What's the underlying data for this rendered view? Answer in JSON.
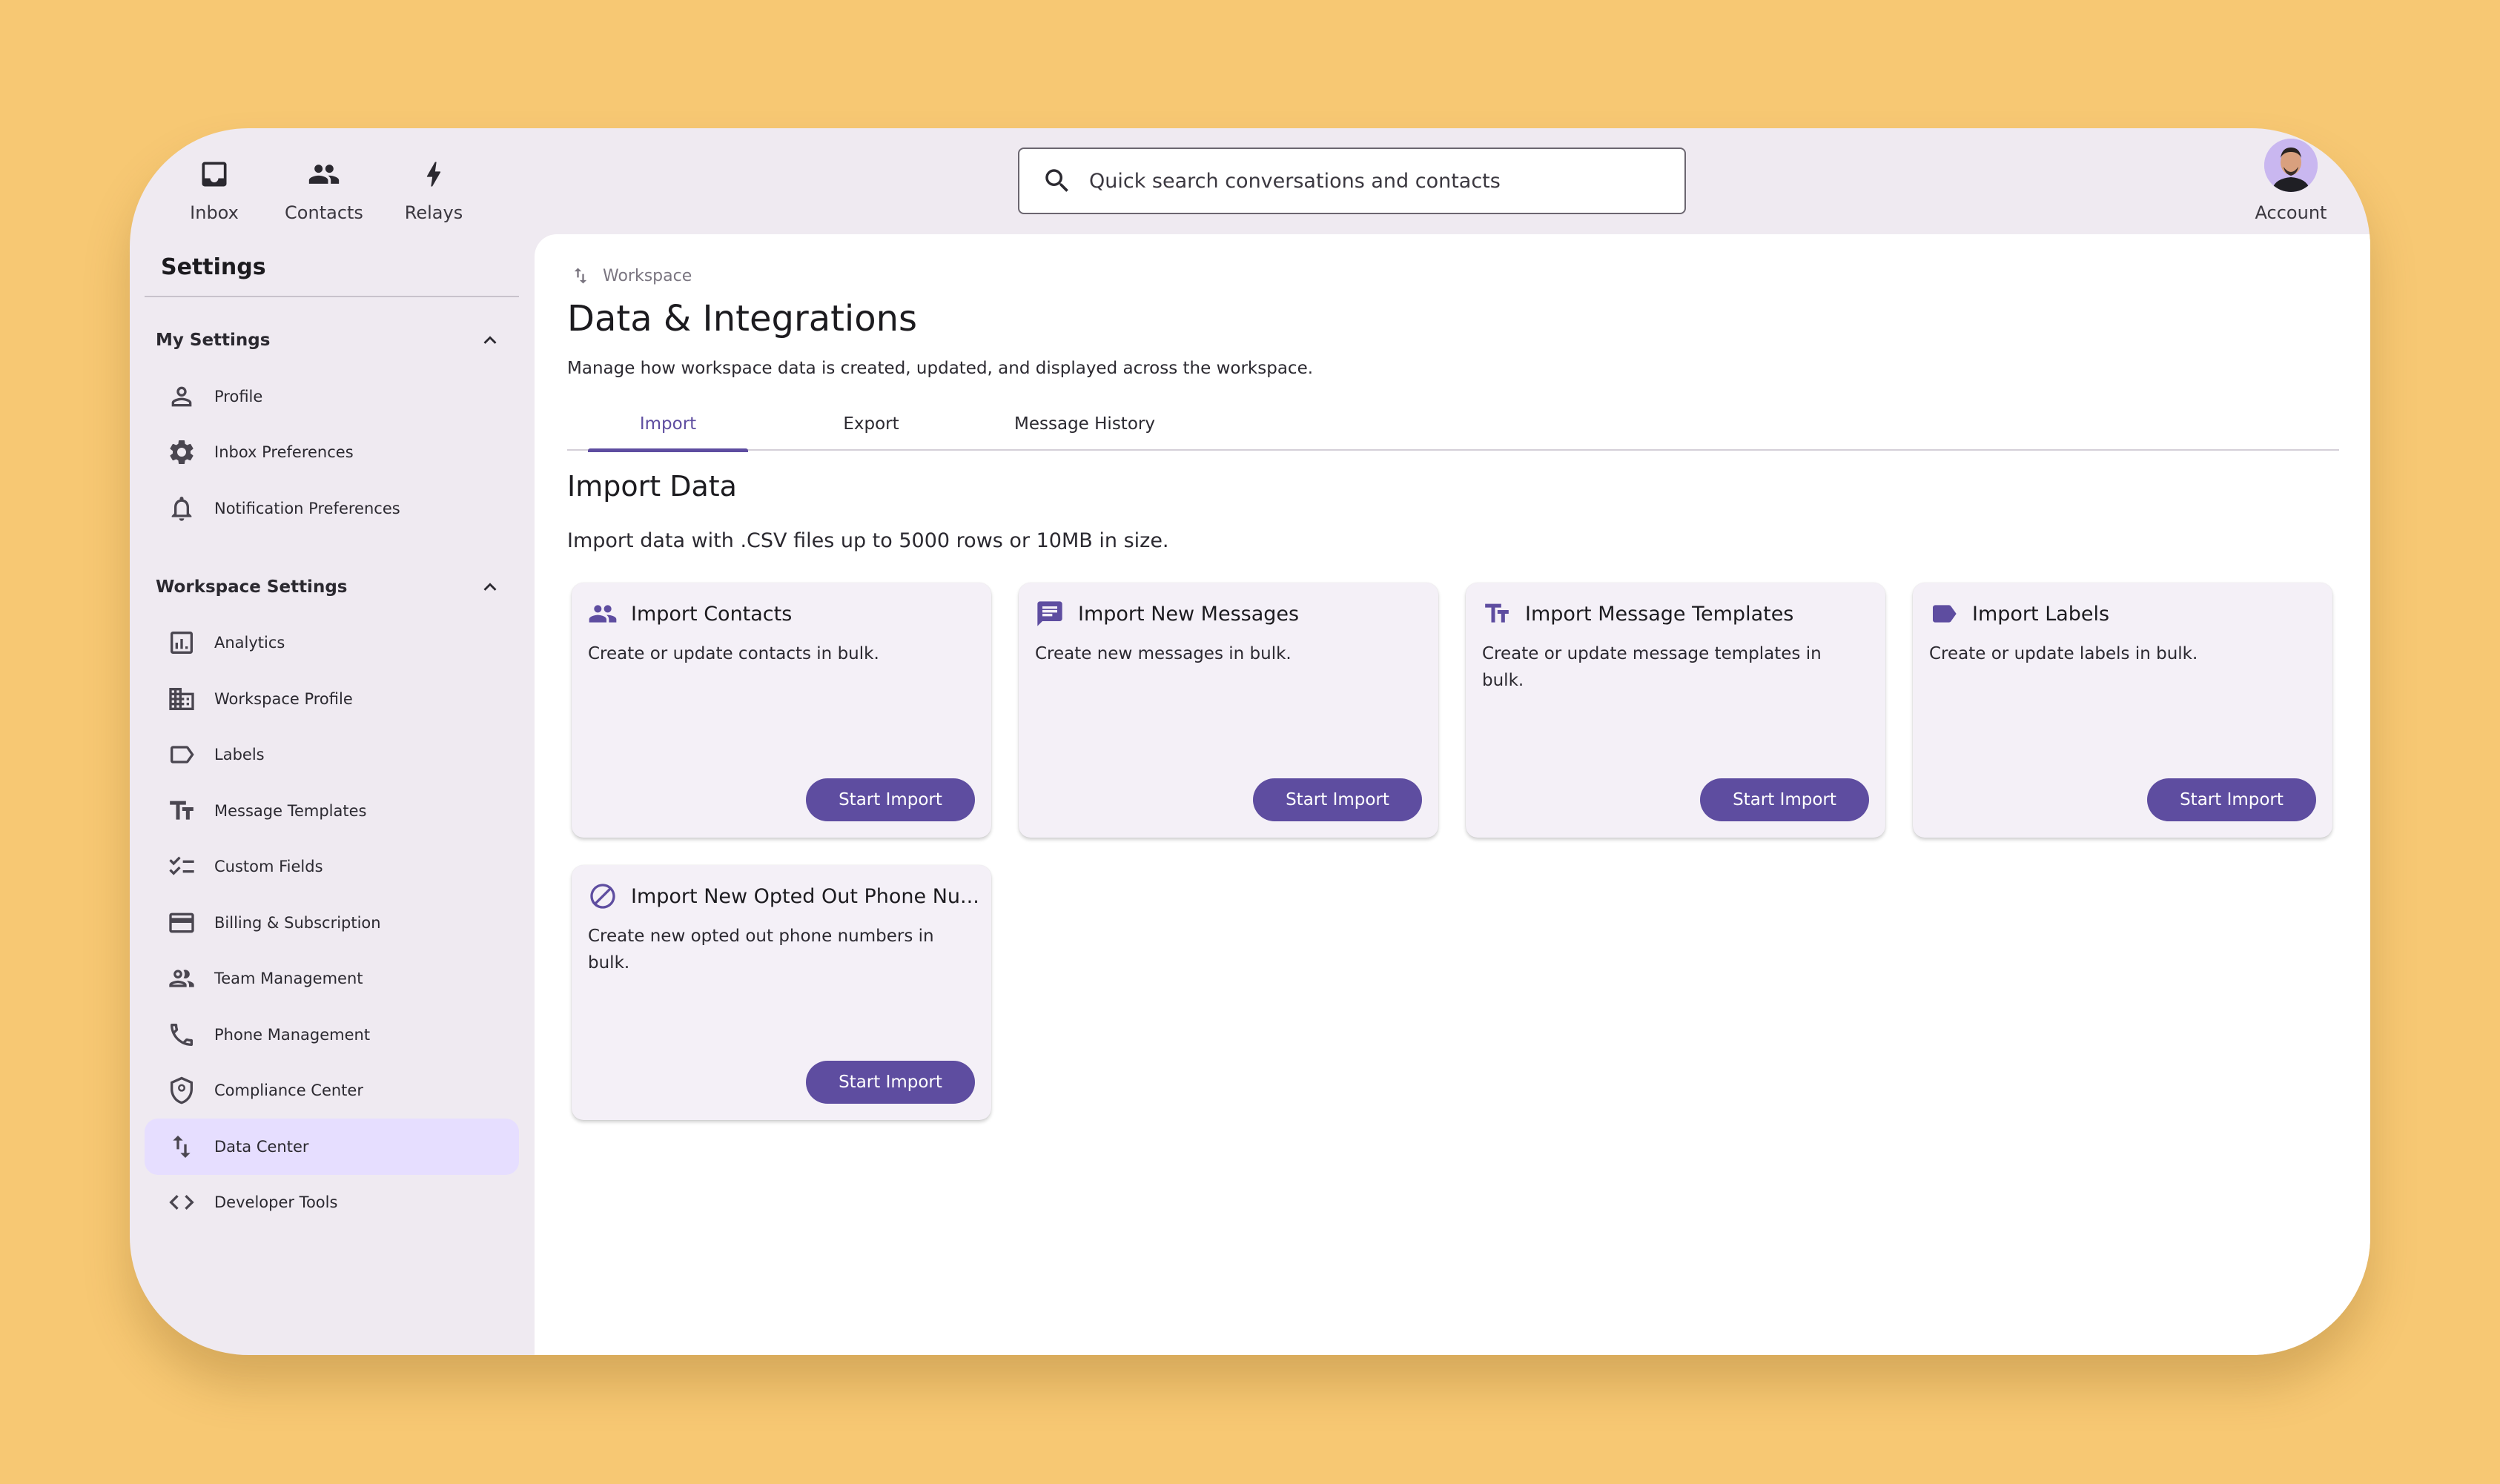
{
  "topnav": {
    "items": [
      {
        "label": "Inbox",
        "icon": "inbox-icon"
      },
      {
        "label": "Contacts",
        "icon": "contacts-icon"
      },
      {
        "label": "Relays",
        "icon": "bolt-icon"
      }
    ],
    "account_label": "Account"
  },
  "search": {
    "placeholder": "Quick search conversations and contacts"
  },
  "sidebar": {
    "title": "Settings",
    "my_settings": {
      "header": "My Settings",
      "items": [
        {
          "label": "Profile",
          "icon": "person-icon"
        },
        {
          "label": "Inbox Preferences",
          "icon": "gear-icon"
        },
        {
          "label": "Notification Preferences",
          "icon": "bell-icon"
        }
      ]
    },
    "workspace_settings": {
      "header": "Workspace Settings",
      "items": [
        {
          "label": "Analytics",
          "icon": "analytics-icon"
        },
        {
          "label": "Workspace Profile",
          "icon": "building-icon"
        },
        {
          "label": "Labels",
          "icon": "label-icon"
        },
        {
          "label": "Message Templates",
          "icon": "text-icon"
        },
        {
          "label": "Custom Fields",
          "icon": "checklist-icon"
        },
        {
          "label": "Billing & Subscription",
          "icon": "card-icon"
        },
        {
          "label": "Team Management",
          "icon": "team-icon"
        },
        {
          "label": "Phone Management",
          "icon": "phone-icon"
        },
        {
          "label": "Compliance Center",
          "icon": "shield-icon"
        },
        {
          "label": "Data Center",
          "icon": "swap-icon",
          "active": true
        },
        {
          "label": "Developer Tools",
          "icon": "code-icon"
        }
      ]
    }
  },
  "main": {
    "breadcrumb": "Workspace",
    "title": "Data & Integrations",
    "subtitle": "Manage how workspace data is created, updated, and displayed across the workspace.",
    "tabs": [
      {
        "label": "Import",
        "active": true
      },
      {
        "label": "Export"
      },
      {
        "label": "Message History"
      }
    ],
    "section_title": "Import Data",
    "section_subtitle": "Import data with .CSV files up to 5000 rows or 10MB in size.",
    "cards": [
      {
        "title": "Import Contacts",
        "desc": "Create or update contacts in bulk.",
        "button": "Start Import",
        "icon": "contacts-icon"
      },
      {
        "title": "Import New Messages",
        "desc": "Create new messages in bulk.",
        "button": "Start Import",
        "icon": "message-icon"
      },
      {
        "title": "Import Message Templates",
        "desc": "Create or update message templates in bulk.",
        "button": "Start Import",
        "icon": "text-icon"
      },
      {
        "title": "Import Labels",
        "desc": "Create or update labels in bulk.",
        "button": "Start Import",
        "icon": "label-icon"
      },
      {
        "title": "Import New Opted Out Phone Nu...",
        "desc": "Create new opted out phone numbers in bulk.",
        "button": "Start Import",
        "icon": "block-icon"
      }
    ]
  },
  "colors": {
    "accent": "#5E4DA0",
    "background": "#F7C873",
    "active_item": "#E6DEFF"
  }
}
